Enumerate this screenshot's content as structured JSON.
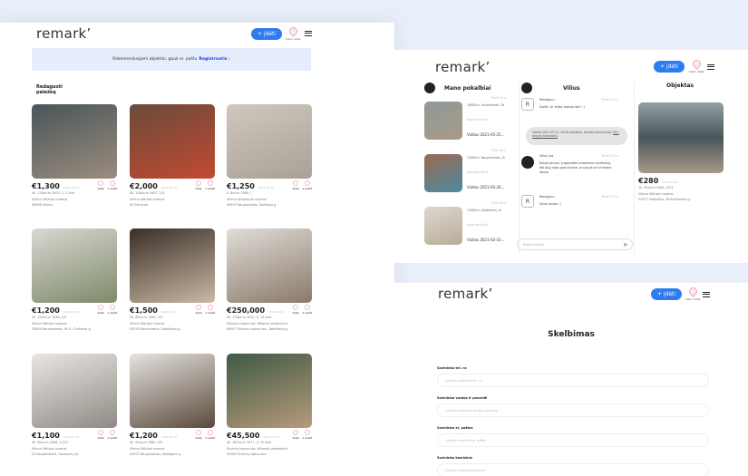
{
  "brand": "remarkʼ",
  "nav": {
    "add_label": "+ įdėti",
    "profile_label": "mano rašai"
  },
  "banner": {
    "text": "Rekomenduojami objektai, gauk el. paštu",
    "link": "Registruotis ›"
  },
  "edit_search": "Redaguoti paiešką",
  "icons": {
    "view": "Vieta",
    "share": "2 aukšt"
  },
  "listings": [
    {
      "price": "€1,300",
      "date": "2021-03-10",
      "l1": "4k. 138кv.m 2003, 2, 2 Arai",
      "l2": "Vilnius Wilaniai nuomai",
      "l3": "08698 Vilnius",
      "c1": "#4a5559",
      "c2": "#9a8d7e"
    },
    {
      "price": "€2,000",
      "date": "2021-03-10",
      "l1": "4k. 138кv.m 2001, 1/3",
      "l2": "Vilnius Wilubai nuomai",
      "l3": "6t Žvėrynas",
      "c1": "#6b4a3a",
      "c2": "#c24a32"
    },
    {
      "price": "€1,250",
      "date": "2021-03-10",
      "l1": "k. 8кv.m 1985, /",
      "l2": "Vilnius Wharaiysk nuomai",
      "l3": "08497 Naujamiestis, Sodžiaus g.",
      "c1": "#cfc8bd",
      "c2": "#a9a197"
    },
    {
      "price": "€1,200",
      "date": "2021-03-10",
      "l1": "3k. 194кv.m 1936, 2/3",
      "l2": "Vilnius Wilubai nuomai",
      "l3": "03620 Naujamiestis, M. K. Čiurlionio g.",
      "c1": "#dad7d2",
      "c2": "#7d8a6a"
    },
    {
      "price": "€1,500",
      "date": "2021-03-10",
      "l1": "3k. 88кv.m 1940, 2/3",
      "l2": "Vilnius Wilubai nuomai",
      "l3": "03578 Senamiestis, Subačiaus g.",
      "c1": "#3a2e28",
      "c2": "#c9b9a4"
    },
    {
      "price": "€250,000",
      "date": "2021-03-10",
      "l1": "5k. 176кv.m 2010, 3, 13 Arai",
      "l2": "Vilniaus rajono sav. Wilamai pardavimui",
      "l3": "08917 Vilniaus rajono sav., Rokiškėlių g.",
      "c1": "#e0ddd8",
      "c2": "#8a7a6a"
    },
    {
      "price": "€1,100",
      "date": "2021-03-10",
      "l1": "3k. 90кv.m 2006, 27/27",
      "l2": "Vilnius Wilubai nuomai",
      "l3": "01 Naujamiestis, Savanorių pr.",
      "c1": "#e9e6e2",
      "c2": "#8f8a84"
    },
    {
      "price": "€1,200",
      "date": "2021-03-10",
      "l1": "3k. 90кv.m 1980, 5/5",
      "l2": "Vilnius Wilubai nuomai",
      "l3": "04672 Naujamiestis, Vaidilgirio g.",
      "c1": "#e6e3df",
      "c2": "#5a4a3c"
    },
    {
      "price": "€45,500",
      "date": "2021-03-10",
      "l1": "4k. 187кv.m 1977, 3, 20 Arai",
      "l2": "Širvintų rajono sav. Wilamai pardavimui",
      "l3": "03089 Širvintų rajono sav.",
      "c1": "#3f5a45",
      "c2": "#b79a7a"
    }
  ],
  "chat": {
    "title_left": "Mano pokalbiai",
    "title_mid": "Vilius",
    "title_right": "Objektas",
    "convs": [
      {
        "when": "Prieš 20 d",
        "addr": "1900Eur. Senamiestis, Te",
        "agent": "Agentas Vilius",
        "visit": "Vizitas 2021-05-25...",
        "c1": "#8f9a98",
        "c2": "#a89a88"
      },
      {
        "when": "Prieš 20 d",
        "addr": "1200Eur. Naujamiestis, N",
        "agent": "Agentas Vilius",
        "visit": "Vizitas 2021-05-20...",
        "c1": "#9c6a50",
        "c2": "#4a8aa0"
      },
      {
        "when": "Prieš 20 d",
        "addr": "1350Eur. Antakalnis, Ie",
        "agent": "Agentas Vilius",
        "visit": "Vizitas 2021-02-10...",
        "c1": "#ddd7cf",
        "c2": "#b9ac9a"
      }
    ],
    "messages": [
      {
        "from": "Remigijus :",
        "when": "Prieš 120 d",
        "text": "Sveiki. Ar būtas laisvas dar? :)"
      },
      {
        "from": "Vilius Jud",
        "when": "Prieš 120 d",
        "text": "Butas laisvas, sugalvokite sutarkime susitikimą, dėl Jūsų laiko pasirinkime, ar paryje ar ne šiame dienai"
      },
      {
        "from": "Remigijus :",
        "when": "Prieš 120 d",
        "text": "Gerai sausiu :)"
      }
    ],
    "bubble": "Vizitas 2021-03-11, 16:00 suteiktas. Kvietas patvirtintas.",
    "bubble_link": "Eiti į aktyvą kalendorių",
    "input_placeholder": "Rašyti žinutę",
    "object": {
      "price": "€280",
      "date": "2021-03-10",
      "l1": "1k. 39кv.m 2006, 5/13",
      "l2": "Vilnius Wilubai nuomai",
      "l3": "03477 Pašilaičiai, Perkūnkiemio g."
    }
  },
  "form": {
    "title": "Skelbimas",
    "fields": [
      {
        "label": "Savininko tel. nr.",
        "placeholder": "įveskite savininko tel. nr."
      },
      {
        "label": "Savininko vardas ir pavardė",
        "placeholder": "įveskite savininko vardą ir pavardę"
      },
      {
        "label": "Savininko el. paštas",
        "placeholder": "įveskite savininko el. paštą"
      },
      {
        "label": "Savininko komisinis",
        "placeholder": "įveskite savininko komisinį"
      }
    ]
  }
}
